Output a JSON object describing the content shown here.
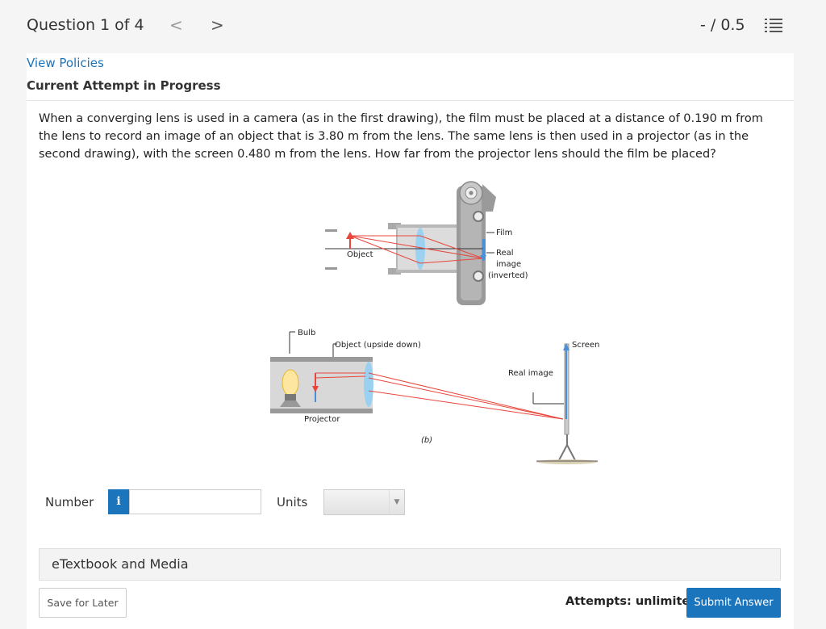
{
  "header": {
    "question_counter": "Question 1 of 4",
    "prev_symbol": "<",
    "next_symbol": ">",
    "score": "- / 0.5"
  },
  "links": {
    "view_policies": "View Policies"
  },
  "attempt_heading": "Current Attempt in Progress",
  "question_text": "When a converging lens is used in a camera (as in the first drawing), the film must be placed at a distance of 0.190 m from the lens to record an image of an object that is 3.80 m from the lens. The same lens is then used in a projector (as in the second drawing), with the screen 0.480 m from the lens. How far from the projector lens should the film be placed?",
  "figure": {
    "labels": {
      "film": "Film",
      "object": "Object",
      "real_image_1": "Real",
      "real_image_2": "image",
      "real_image_3": "(inverted)",
      "bulb": "Bulb",
      "object_upside_down": "Object (upside down)",
      "screen": "Screen",
      "real_image": "Real image",
      "projector": "Projector",
      "part_b": "(b)"
    }
  },
  "answer": {
    "number_label": "Number",
    "info_symbol": "i",
    "number_value": "",
    "units_label": "Units",
    "units_selected": ""
  },
  "media_label": "eTextbook and Media",
  "footer": {
    "save_label": "Save for Later",
    "attempts_text": "Attempts: unlimited",
    "submit_label": "Submit Answer"
  },
  "colors": {
    "accent": "#1b75bc",
    "ray": "#e8463c",
    "lens": "#8fd0f5"
  }
}
